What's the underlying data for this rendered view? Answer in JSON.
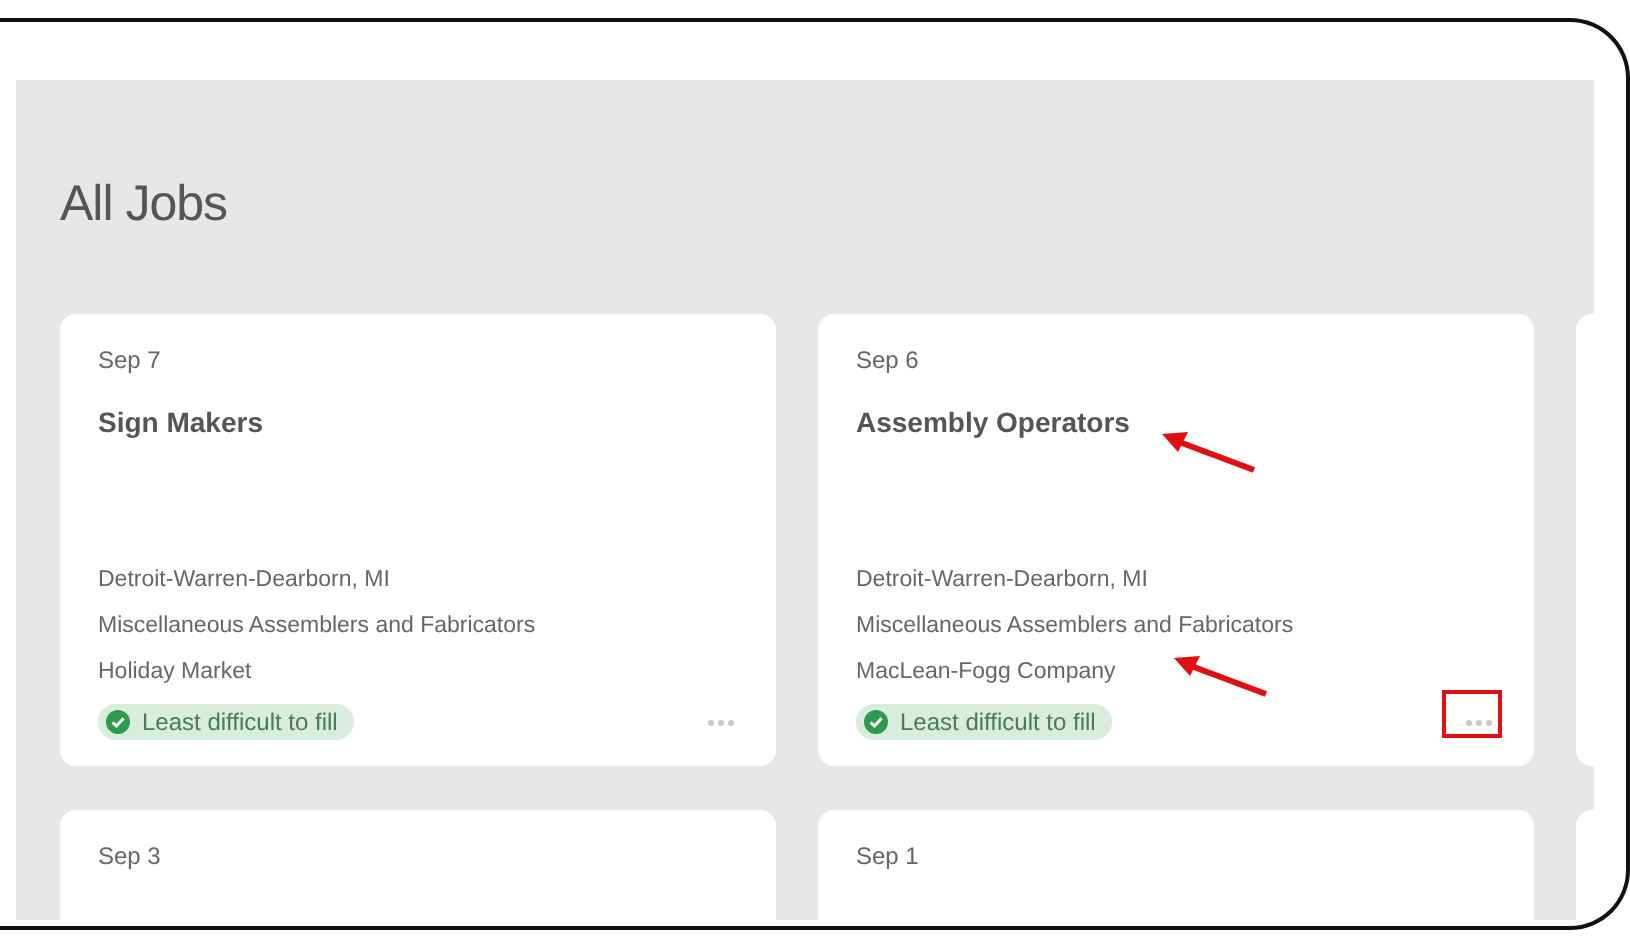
{
  "page": {
    "title": "All Jobs"
  },
  "jobs": [
    {
      "date": "Sep 7",
      "title": "Sign Makers",
      "location": "Detroit-Warren-Dearborn, MI",
      "occupation": "Miscellaneous Assemblers and Fabricators",
      "company": "Holiday Market",
      "badge": "Least difficult to fill",
      "annotated": false
    },
    {
      "date": "Sep 6",
      "title": "Assembly Operators",
      "location": "Detroit-Warren-Dearborn, MI",
      "occupation": "Miscellaneous Assemblers and Fabricators",
      "company": "MacLean-Fogg Company",
      "badge": "Least difficult to fill",
      "annotated": true
    },
    {
      "date": "Sep 3"
    },
    {
      "date": "Sep 1"
    }
  ]
}
